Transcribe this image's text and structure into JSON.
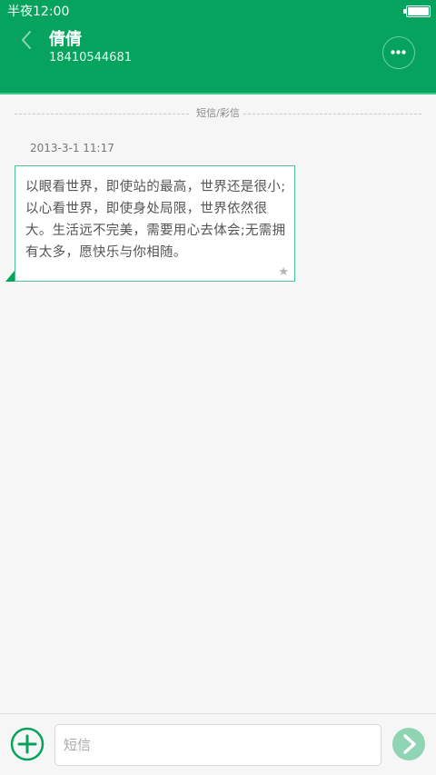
{
  "status_bar": {
    "time": "半夜12:00",
    "battery_level": 1.0
  },
  "header": {
    "back_icon": "chevron-left-icon",
    "contact_name": "倩倩",
    "contact_number": "18410544681",
    "more_icon": "more-dots-icon"
  },
  "conversation": {
    "divider_label": "短信/彩信",
    "messages": [
      {
        "time": "2013-3-1 11:17",
        "text": "以眼看世界，即使站的最高，世界还是很小;以心看世界，即使身处局限，世界依然很大。生活远不完美，需要用心去体会;无需拥有太多，愿快乐与你相随。",
        "starred": true,
        "star_icon": "star-icon"
      }
    ]
  },
  "input_bar": {
    "add_icon": "plus-circle-icon",
    "placeholder": "短信",
    "value": "",
    "send_icon": "send-arrow-icon"
  },
  "colors": {
    "accent": "#05a35e",
    "accent_light": "#4fc493",
    "send_disabled": "#8fd4b3",
    "background": "#f6f6f6"
  }
}
